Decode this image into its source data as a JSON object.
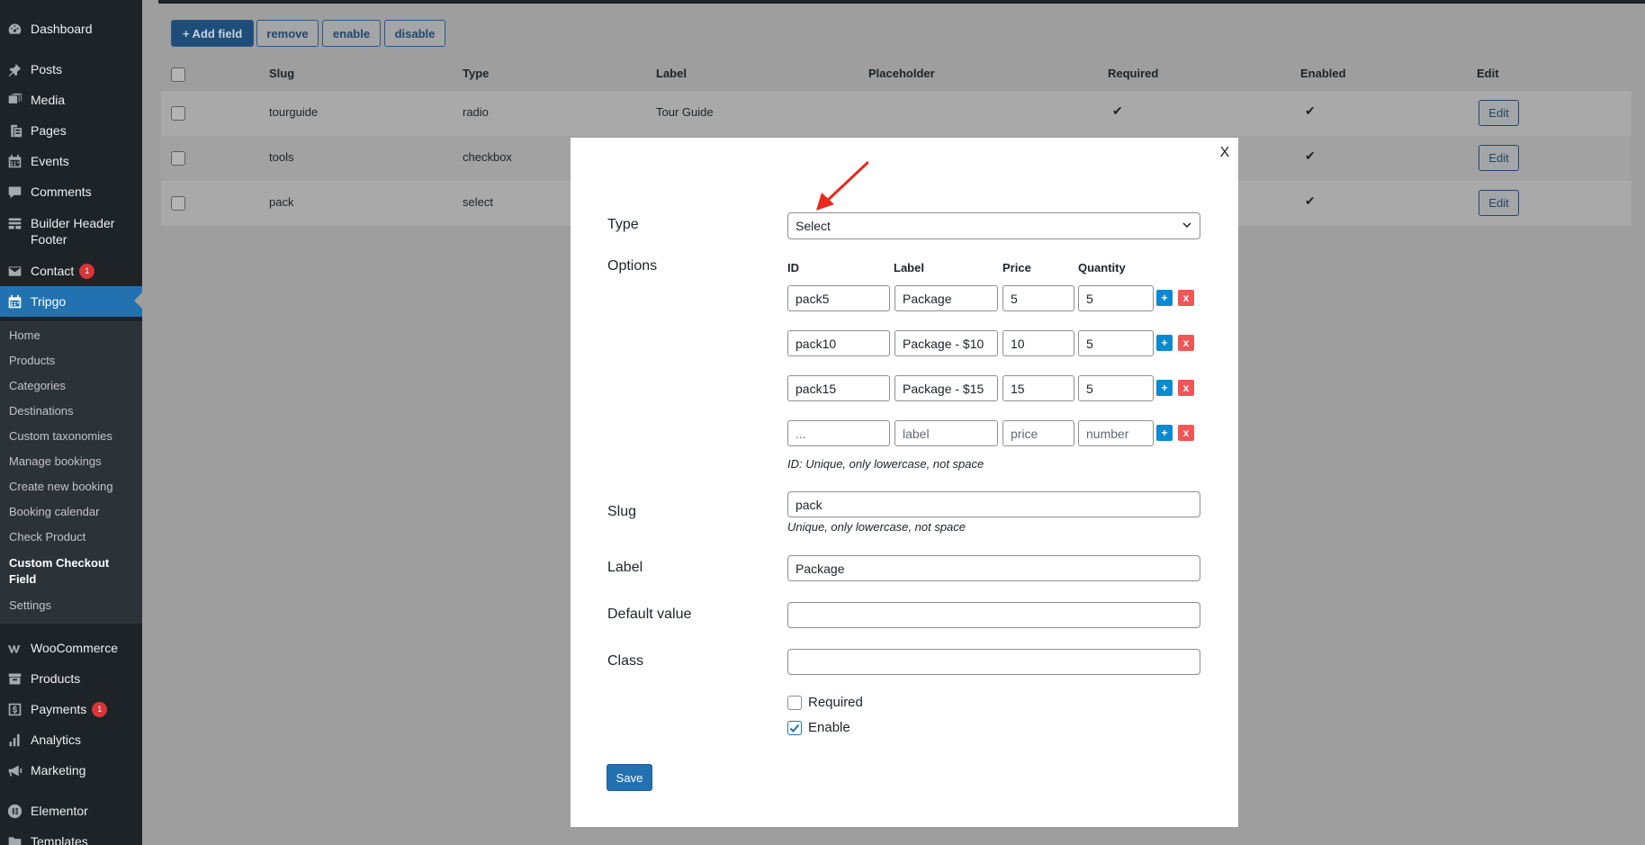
{
  "sidebar": {
    "items": [
      {
        "label": "Dashboard",
        "icon": "dashboard-icon"
      },
      {
        "label": "Posts",
        "icon": "pushpin-icon"
      },
      {
        "label": "Media",
        "icon": "media-icon"
      },
      {
        "label": "Pages",
        "icon": "pages-icon"
      },
      {
        "label": "Events",
        "icon": "calendar-icon"
      },
      {
        "label": "Comments",
        "icon": "comment-icon"
      },
      {
        "label": "Builder Header Footer",
        "icon": "layout-icon"
      },
      {
        "label": "Contact",
        "icon": "mail-icon",
        "badge": "1"
      },
      {
        "label": "Tripgo",
        "icon": "calendar-icon"
      },
      {
        "label": "WooCommerce",
        "icon": "woocommerce-icon"
      },
      {
        "label": "Products",
        "icon": "archive-icon"
      },
      {
        "label": "Payments",
        "icon": "dollar-icon",
        "badge": "1"
      },
      {
        "label": "Analytics",
        "icon": "bar-chart-icon"
      },
      {
        "label": "Marketing",
        "icon": "megaphone-icon"
      },
      {
        "label": "Elementor",
        "icon": "elementor-icon"
      },
      {
        "label": "Templates",
        "icon": "folder-icon"
      }
    ],
    "submenu": [
      "Home",
      "Products",
      "Categories",
      "Destinations",
      "Custom taxonomies",
      "Manage bookings",
      "Create new booking",
      "Booking calendar",
      "Check Product",
      "Custom Checkout Field",
      "Settings"
    ]
  },
  "toolbar": {
    "add_label": "+ Add field",
    "remove_label": "remove",
    "enable_label": "enable",
    "disable_label": "disable"
  },
  "table": {
    "headers": [
      "Slug",
      "Type",
      "Label",
      "Placeholder",
      "Required",
      "Enabled",
      "Edit"
    ],
    "rows": [
      {
        "slug": "tourguide",
        "type": "radio",
        "label": "Tour Guide",
        "placeholder": "",
        "required": "✔",
        "enabled": "✔",
        "edit": "Edit"
      },
      {
        "slug": "tools",
        "type": "checkbox",
        "label": "",
        "placeholder": "",
        "required": "",
        "enabled": "✔",
        "edit": "Edit"
      },
      {
        "slug": "pack",
        "type": "select",
        "label": "",
        "placeholder": "",
        "required": "",
        "enabled": "✔",
        "edit": "Edit"
      }
    ]
  },
  "modal": {
    "close_label": "X",
    "type_label": "Type",
    "type_value": "Select",
    "options_label": "Options",
    "options_headers": [
      "ID",
      "Label",
      "Price",
      "Quantity"
    ],
    "options": [
      {
        "id": "pack5",
        "label": "Package",
        "price": "5",
        "quantity": "5"
      },
      {
        "id": "pack10",
        "label": "Package - $10",
        "price": "10",
        "quantity": "5"
      },
      {
        "id": "pack15",
        "label": "Package - $15",
        "price": "15",
        "quantity": "5"
      }
    ],
    "new_option_placeholders": {
      "id": "...",
      "label": "label",
      "price": "price",
      "quantity": "number"
    },
    "plus_label": "+",
    "remove_label": "x",
    "id_hint": "ID: Unique, only lowercase, not space",
    "slug_label": "Slug",
    "slug_value": "pack",
    "slug_hint": "Unique, only lowercase, not space",
    "label_label": "Label",
    "label_value": "Package",
    "default_label": "Default value",
    "default_value": "",
    "class_label": "Class",
    "class_value": "",
    "required_label": "Required",
    "required_checked": false,
    "enable_label": "Enable",
    "enable_checked": true,
    "save_label": "Save"
  },
  "colors": {
    "admin_dark": "#1d2327",
    "accent_blue": "#2271b1",
    "overlay_gray": "#9e9e9e",
    "plus_blue": "#0b8ad0",
    "remove_red": "#f05656",
    "annotation_red": "#e8291c"
  }
}
